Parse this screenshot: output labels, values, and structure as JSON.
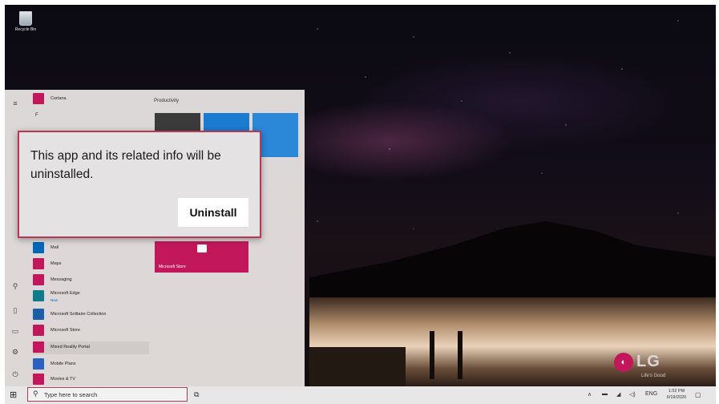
{
  "desktop": {
    "recycle_bin_label": "Recycle Bin",
    "logo": {
      "brand": "LG",
      "tagline": "Life's Good",
      "color": "#c2185b"
    }
  },
  "start_menu": {
    "apps": [
      {
        "label": "Cortana",
        "color": "#c2185b"
      },
      {
        "label": "F",
        "type": "letter"
      },
      {
        "label": "Mail",
        "color": "#0067b8"
      },
      {
        "label": "Maps",
        "color": "#c2185b"
      },
      {
        "label": "Messaging",
        "color": "#c2185b"
      },
      {
        "label": "Microsoft Edge",
        "sub": "New",
        "color": "#0f7a8a"
      },
      {
        "label": "Microsoft Solitaire Collection",
        "color": "#1b5fa8"
      },
      {
        "label": "Microsoft Store",
        "color": "#c2185b"
      },
      {
        "label": "Mixed Reality Portal",
        "color": "#c2185b"
      },
      {
        "label": "Mobile Plans",
        "color": "#2b62c2"
      },
      {
        "label": "Movies & TV",
        "color": "#c2185b"
      }
    ],
    "group_title": "Productivity",
    "store_tile_label": "Microsoft Store"
  },
  "dialog": {
    "message": "This app and its related info will be uninstalled.",
    "button_label": "Uninstall",
    "border_color": "#b23a55"
  },
  "taskbar": {
    "search_placeholder": "Type here to search",
    "tray": {
      "language": "ENG",
      "time": "1:52 PM",
      "date": "6/19/2020"
    }
  }
}
